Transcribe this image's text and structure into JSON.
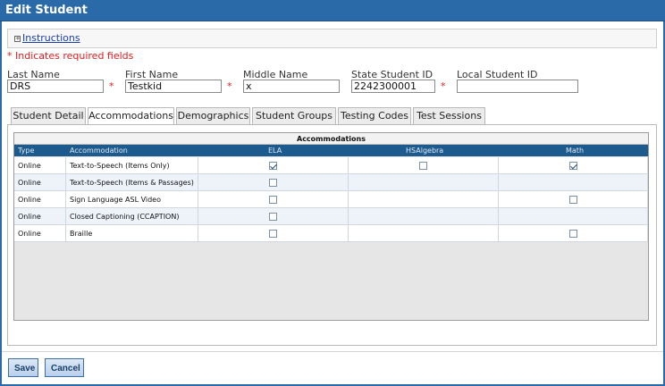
{
  "window": {
    "title": "Edit Student"
  },
  "instructions": {
    "label": "Instructions"
  },
  "required_note": "* Indicates required fields",
  "fields": {
    "last_name": {
      "label": "Last Name",
      "value": "DRS"
    },
    "first_name": {
      "label": "First Name",
      "value": "Testkid"
    },
    "middle_name": {
      "label": "Middle Name",
      "value": "x"
    },
    "state_id": {
      "label": "State Student ID",
      "value": "2242300001"
    },
    "local_id": {
      "label": "Local Student ID",
      "value": ""
    }
  },
  "required_marker": "*",
  "tabs": [
    {
      "label": "Student Detail"
    },
    {
      "label": "Accommodations"
    },
    {
      "label": "Demographics"
    },
    {
      "label": "Student Groups"
    },
    {
      "label": "Testing Codes"
    },
    {
      "label": "Test Sessions"
    }
  ],
  "grid": {
    "title": "Accommodations",
    "columns": [
      "Type",
      "Accommodation",
      "ELA",
      "HSAlgebra",
      "Math"
    ],
    "rows": [
      {
        "type": "Online",
        "accommodation": "Text-to-Speech (Items Only)",
        "ela": "checked",
        "hsalgebra": "unchecked",
        "math": "checked"
      },
      {
        "type": "Online",
        "accommodation": "Text-to-Speech (Items & Passages)",
        "ela": "unchecked",
        "hsalgebra": "none",
        "math": "none"
      },
      {
        "type": "Online",
        "accommodation": "Sign Language ASL Video",
        "ela": "unchecked",
        "hsalgebra": "none",
        "math": "unchecked"
      },
      {
        "type": "Online",
        "accommodation": "Closed Captioning (CCAPTION)",
        "ela": "unchecked",
        "hsalgebra": "none",
        "math": "none"
      },
      {
        "type": "Online",
        "accommodation": "Braille",
        "ela": "unchecked",
        "hsalgebra": "none",
        "math": "unchecked"
      }
    ]
  },
  "buttons": {
    "save": "Save",
    "cancel": "Cancel"
  },
  "colors": {
    "title_bar": "#2b6aa8",
    "grid_header": "#1d5b8f",
    "required": "#e41b1b"
  }
}
